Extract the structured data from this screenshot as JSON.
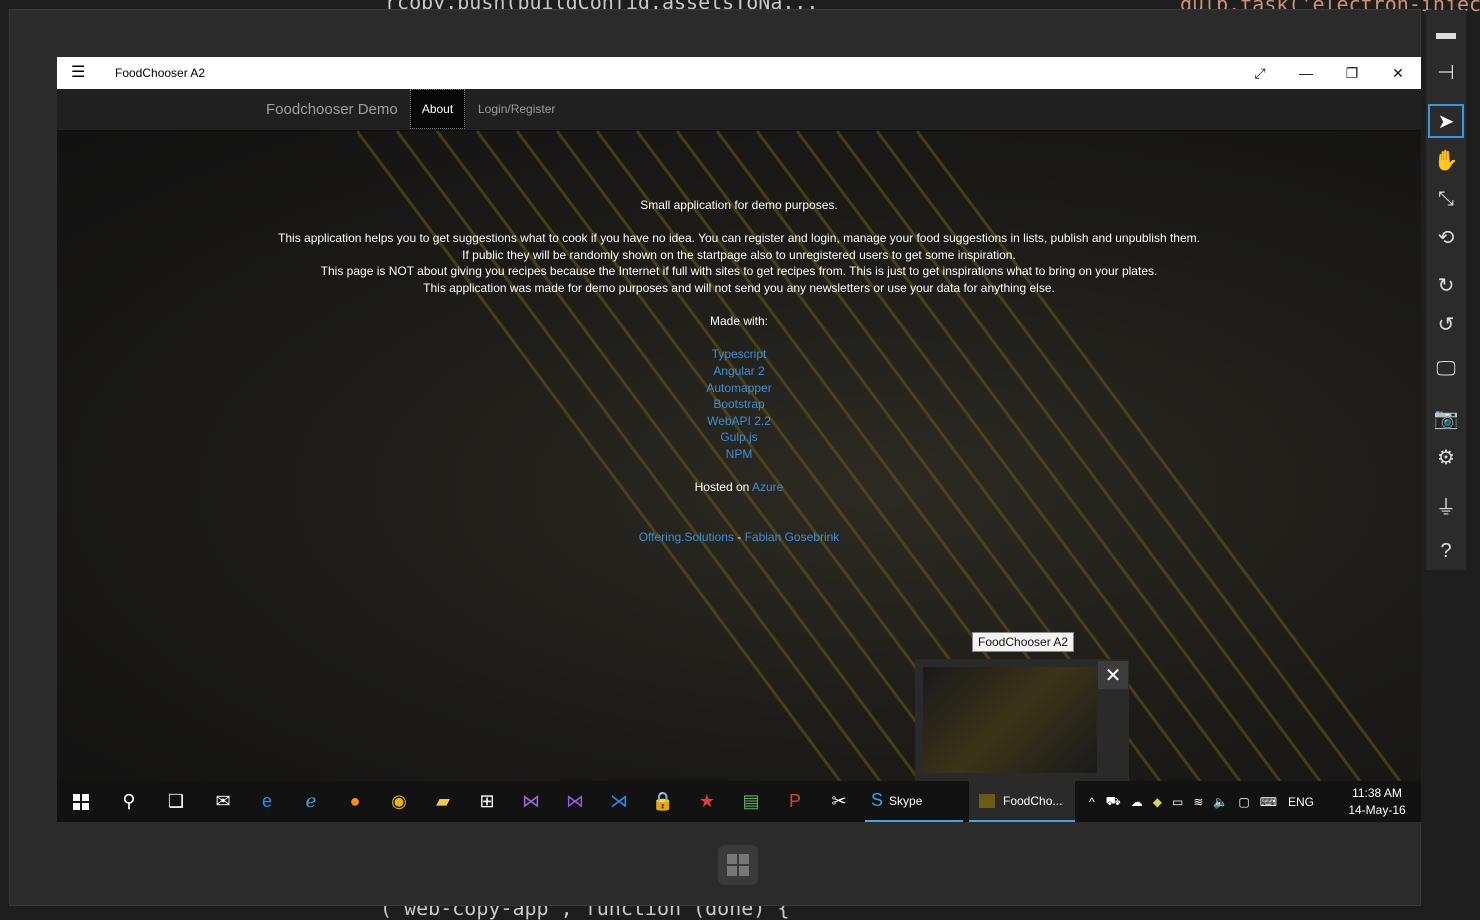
{
  "background": {
    "code_top": "rcopy.push(buildConfig.assetsToNa...",
    "code_top_right": "gulp.task('electron-inject",
    "code_bottom": "( web-copy-app , function (done) {"
  },
  "window": {
    "title": "FoodChooser A2",
    "icons": [
      "hamburger-icon",
      "expand-icon",
      "minimize-icon",
      "restore-icon",
      "close-icon"
    ]
  },
  "navbar": {
    "brand": "Foodchooser Demo",
    "items": [
      {
        "label": "About",
        "active": true
      },
      {
        "label": "Login/Register",
        "active": false
      }
    ]
  },
  "about": {
    "intro": "Small application for demo purposes.",
    "description_1": "This application helps you to get suggestions what to cook if you have no idea. You can register and login, manage your food suggestions in lists, publish and unpublish them. If public they will be randomly shown on the startpage also to unregistered users to get some inspiration.",
    "description_2": "This page is NOT about giving you recipes because the Internet if full with sites to get recipes from. This is just to get inspirations what to bring on your plates.",
    "description_3": "This application was made for demo purposes and will not send you any newsletters or use your data for anything else.",
    "made_with_label": "Made with:",
    "technologies": [
      "Typescript",
      "Angular 2",
      "Automapper",
      "Bootstrap",
      "WebAPI 2.2",
      "Gulp.js",
      "NPM"
    ],
    "hosted_on_label": "Hosted on",
    "hosted_on_link": "Azure",
    "footer_link_1": "Offering.Solutions",
    "footer_separator": "-",
    "footer_link_2": "Fabian Gosebrink"
  },
  "taskbar": {
    "skype_label": "Skype",
    "food_label": "FoodCho...",
    "lang": "ENG",
    "time": "11:38 AM",
    "date": "14-May-16"
  },
  "thumbnail": {
    "label": "FoodChooser A2"
  },
  "colors": {
    "link": "#3d8fd6",
    "accent": "#3a96dd",
    "navbar": "#202020"
  }
}
